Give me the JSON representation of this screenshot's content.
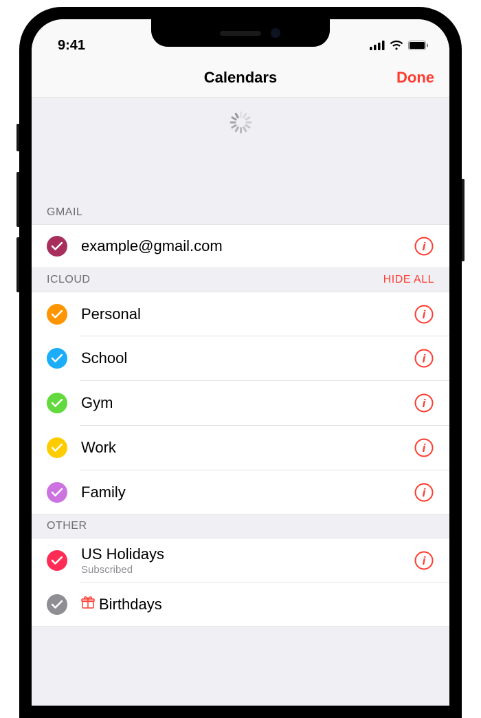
{
  "status": {
    "time": "9:41"
  },
  "nav": {
    "title": "Calendars",
    "done": "Done"
  },
  "sections": [
    {
      "id": "gmail",
      "header": "GMAIL",
      "action": null,
      "items": [
        {
          "label": "example@gmail.com",
          "sublabel": null,
          "color": "c-crimson",
          "checked": true,
          "info": true,
          "gift": false
        }
      ]
    },
    {
      "id": "icloud",
      "header": "ICLOUD",
      "action": "HIDE ALL",
      "items": [
        {
          "label": "Personal",
          "sublabel": null,
          "color": "c-orange",
          "checked": true,
          "info": true,
          "gift": false
        },
        {
          "label": "School",
          "sublabel": null,
          "color": "c-blue",
          "checked": true,
          "info": true,
          "gift": false
        },
        {
          "label": "Gym",
          "sublabel": null,
          "color": "c-green",
          "checked": true,
          "info": true,
          "gift": false
        },
        {
          "label": "Work",
          "sublabel": null,
          "color": "c-yellow",
          "checked": true,
          "info": true,
          "gift": false
        },
        {
          "label": "Family",
          "sublabel": null,
          "color": "c-purple",
          "checked": true,
          "info": true,
          "gift": false
        }
      ]
    },
    {
      "id": "other",
      "header": "OTHER",
      "action": null,
      "items": [
        {
          "label": "US Holidays",
          "sublabel": "Subscribed",
          "color": "c-pink",
          "checked": true,
          "info": true,
          "gift": false
        },
        {
          "label": "Birthdays",
          "sublabel": null,
          "color": "c-gray",
          "checked": true,
          "info": false,
          "gift": true
        }
      ]
    }
  ]
}
